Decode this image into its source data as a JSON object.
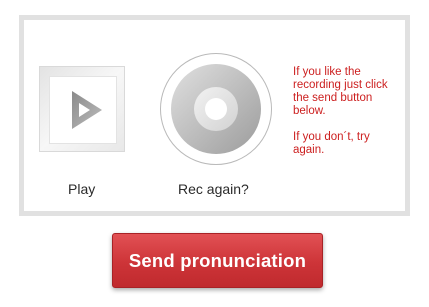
{
  "player": {
    "play_label": "Play",
    "play_icon": "play-icon",
    "rec_label": "Rec again?",
    "rec_icon": "record-disc-icon"
  },
  "instructions": {
    "line1": "If you like the recording just click the send button below.",
    "line2": "If you don´t, try again."
  },
  "actions": {
    "send_label": "Send pronunciation"
  },
  "colors": {
    "accent": "#cd3438",
    "instruction_text": "#cc1f1f",
    "panel_border": "#e1e1e1"
  }
}
